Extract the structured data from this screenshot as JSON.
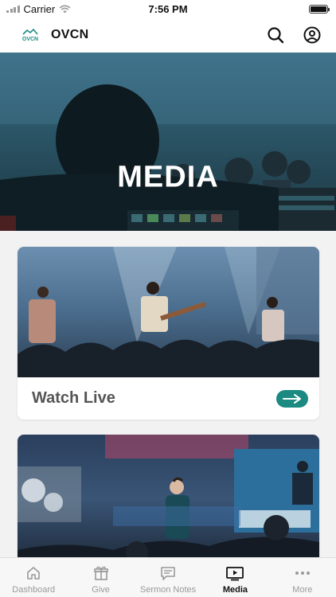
{
  "status_bar": {
    "carrier": "Carrier",
    "time": "7:56 PM"
  },
  "header": {
    "logo_text": "OVCN",
    "title": "OVCN",
    "search_icon": "search-icon",
    "profile_icon": "user-circle-icon"
  },
  "hero": {
    "title": "MEDIA"
  },
  "cards": [
    {
      "label": "Watch Live",
      "action_icon": "arrow-right-icon"
    },
    {
      "label": ""
    }
  ],
  "tabs": [
    {
      "label": "Dashboard",
      "icon": "home-icon",
      "active": false
    },
    {
      "label": "Give",
      "icon": "gift-icon",
      "active": false
    },
    {
      "label": "Sermon Notes",
      "icon": "note-icon",
      "active": false
    },
    {
      "label": "Media",
      "icon": "play-icon",
      "active": true
    },
    {
      "label": "More",
      "icon": "more-icon",
      "active": false
    }
  ],
  "colors": {
    "accent": "#1b8a80",
    "active_tab": "#111111",
    "inactive_tab": "#999999"
  }
}
